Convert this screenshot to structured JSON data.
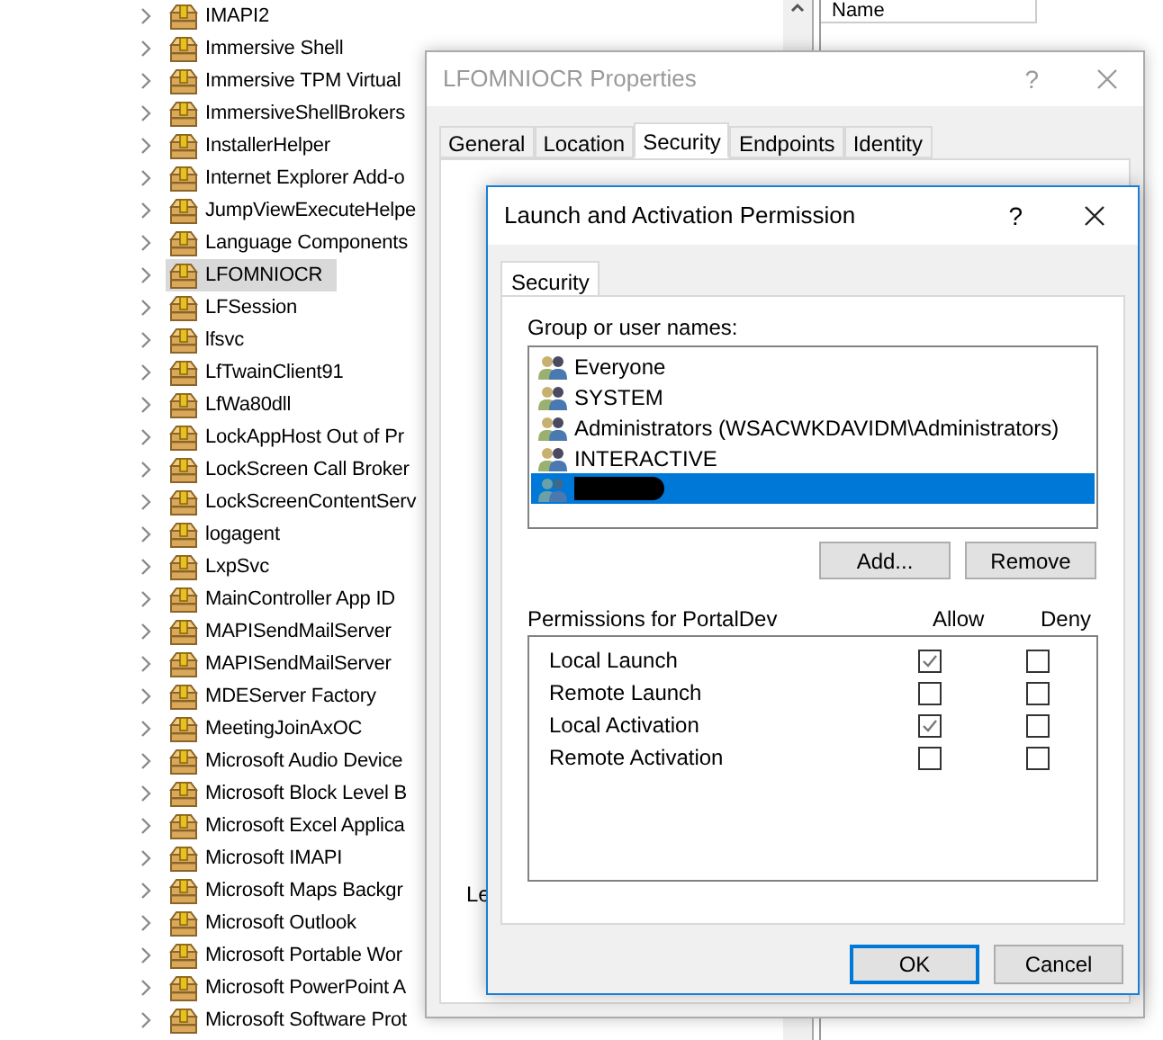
{
  "tree": {
    "items": [
      {
        "label": "IMAPI2",
        "selected": false
      },
      {
        "label": "Immersive Shell",
        "selected": false
      },
      {
        "label": "Immersive TPM Virtual",
        "selected": false
      },
      {
        "label": "ImmersiveShellBrokers",
        "selected": false
      },
      {
        "label": "InstallerHelper",
        "selected": false
      },
      {
        "label": "Internet Explorer Add-o",
        "selected": false
      },
      {
        "label": "JumpViewExecuteHelpe",
        "selected": false
      },
      {
        "label": "Language Components",
        "selected": false
      },
      {
        "label": "LFOMNIOCR",
        "selected": true
      },
      {
        "label": "LFSession",
        "selected": false
      },
      {
        "label": "lfsvc",
        "selected": false
      },
      {
        "label": "LfTwainClient91",
        "selected": false
      },
      {
        "label": "LfWa80dll",
        "selected": false
      },
      {
        "label": "LockAppHost Out of Pr",
        "selected": false
      },
      {
        "label": "LockScreen Call Broker",
        "selected": false
      },
      {
        "label": "LockScreenContentServ",
        "selected": false
      },
      {
        "label": "logagent",
        "selected": false
      },
      {
        "label": "LxpSvc",
        "selected": false
      },
      {
        "label": "MainController App ID",
        "selected": false
      },
      {
        "label": "MAPISendMailServer",
        "selected": false
      },
      {
        "label": "MAPISendMailServer",
        "selected": false
      },
      {
        "label": "MDEServer Factory",
        "selected": false
      },
      {
        "label": "MeetingJoinAxOC",
        "selected": false
      },
      {
        "label": "Microsoft Audio Device",
        "selected": false
      },
      {
        "label": "Microsoft Block Level B",
        "selected": false
      },
      {
        "label": "Microsoft Excel Applica",
        "selected": false
      },
      {
        "label": "Microsoft IMAPI",
        "selected": false
      },
      {
        "label": "Microsoft Maps Backgr",
        "selected": false
      },
      {
        "label": "Microsoft Outlook",
        "selected": false
      },
      {
        "label": "Microsoft Portable Wor",
        "selected": false
      },
      {
        "label": "Microsoft PowerPoint A",
        "selected": false
      },
      {
        "label": "Microsoft Software Prot",
        "selected": false
      }
    ]
  },
  "list_header": {
    "column_1": "Name"
  },
  "properties_window": {
    "title": "LFOMNIOCR Properties",
    "help": "?",
    "tabs": [
      {
        "label": "General",
        "selected": false
      },
      {
        "label": "Location",
        "selected": false
      },
      {
        "label": "Security",
        "selected": true
      },
      {
        "label": "Endpoints",
        "selected": false
      },
      {
        "label": "Identity",
        "selected": false
      }
    ],
    "partial_label": "Le"
  },
  "dialog": {
    "title": "Launch and Activation Permission",
    "help": "?",
    "tabs": [
      {
        "label": "Security",
        "selected": true
      }
    ],
    "group_label": "Group or user names:",
    "users": [
      {
        "name": "Everyone",
        "selected": false,
        "redacted": false
      },
      {
        "name": "SYSTEM",
        "selected": false,
        "redacted": false
      },
      {
        "name": "Administrators (WSACWKDAVIDM\\Administrators)",
        "selected": false,
        "redacted": false
      },
      {
        "name": "INTERACTIVE",
        "selected": false,
        "redacted": false
      },
      {
        "selected": true,
        "redacted": true
      }
    ],
    "user_buttons": [
      "Add...",
      "Remove"
    ],
    "permissions_label": "Permissions for PortalDev",
    "allow_header": "Allow",
    "deny_header": "Deny",
    "permissions": [
      {
        "name": "Local Launch",
        "allow": true,
        "deny": false
      },
      {
        "name": "Remote Launch",
        "allow": false,
        "deny": false
      },
      {
        "name": "Local Activation",
        "allow": true,
        "deny": false
      },
      {
        "name": "Remote Activation",
        "allow": false,
        "deny": false
      }
    ],
    "buttons": [
      {
        "label": "OK",
        "kind": "default"
      },
      {
        "label": "Cancel",
        "kind": "normal"
      }
    ]
  }
}
